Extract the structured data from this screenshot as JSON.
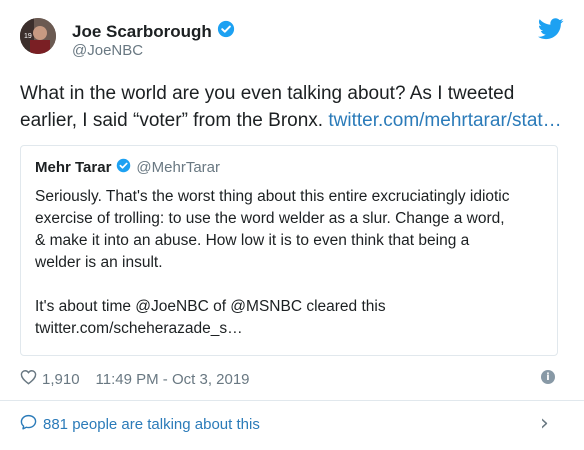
{
  "user": {
    "name": "Joe Scarborough",
    "handle": "@JoeNBC",
    "verified_icon": "verified-badge-icon",
    "avatar_icon": "avatar"
  },
  "tweet": {
    "text": "What in the world are you even talking about? As I tweeted earlier, I said “voter” from the Bronx. ",
    "link_text": "twitter.com/mehrtarar/stat…"
  },
  "quote": {
    "name": "Mehr Tarar",
    "handle": "@MehrTarar",
    "lines": [
      "Seriously. That's the worst thing about this entire excruciatingly idiotic",
      "exercise of trolling: to use the word welder as a slur. Change a word,",
      "& make it into an abuse. How low it is to even think that being a",
      "welder is an insult."
    ],
    "lines2": [
      "It's about time @JoeNBC of @MSNBC cleared this",
      "twitter.com/scheherazade_s…"
    ]
  },
  "meta": {
    "likes": "1,910",
    "timestamp": "11:49 PM - Oct 3, 2019"
  },
  "footer": {
    "talking": "881 people are talking about this"
  },
  "colors": {
    "accent": "#1da1f2",
    "link": "#2b7bb9",
    "muted": "#697882"
  }
}
